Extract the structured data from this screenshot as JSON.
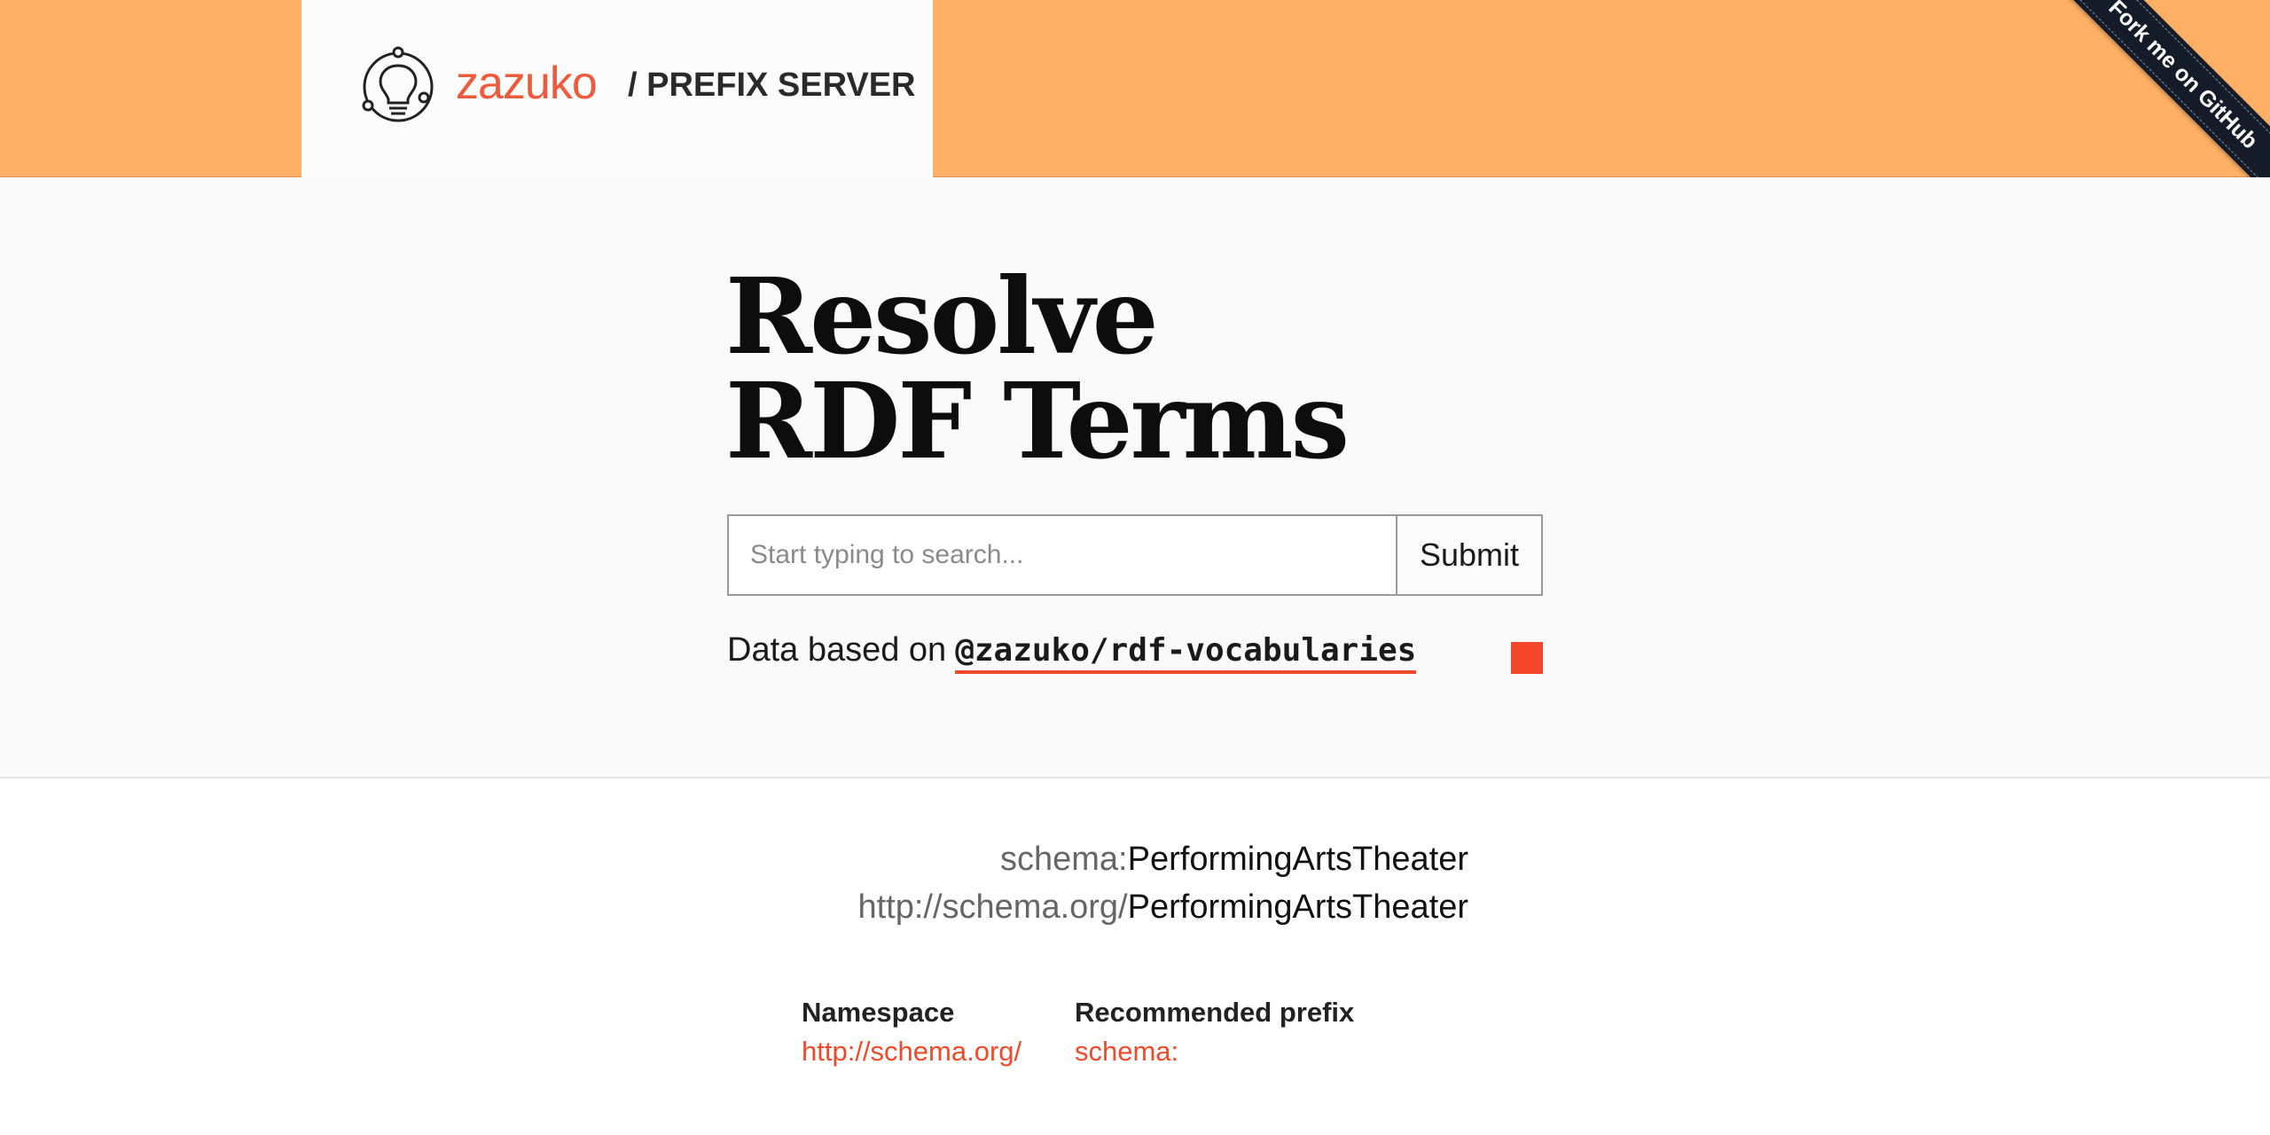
{
  "header": {
    "logo_text": "zazuko",
    "section_title": "/ PREFIX SERVER",
    "ribbon_text": "Fork me on GitHub"
  },
  "hero": {
    "title_line1": "Resolve",
    "title_line2": "RDF Terms",
    "search_placeholder": "Start typing to search...",
    "submit_label": "Submit",
    "data_prefix": "Data based on",
    "data_package": "@zazuko/rdf-vocabularies"
  },
  "result": {
    "prefix": "schema:",
    "term": "PerformingArtsTheater",
    "namespace_iri": "http://schema.org/",
    "term_full": "PerformingArtsTheater",
    "namespace_label": "Namespace",
    "namespace_value": "http://schema.org/",
    "prefix_label": "Recommended prefix",
    "prefix_value": "schema:"
  },
  "colors": {
    "header_bg": "#ffb066",
    "accent": "#f04a2a",
    "ribbon_bg": "#151c29"
  }
}
